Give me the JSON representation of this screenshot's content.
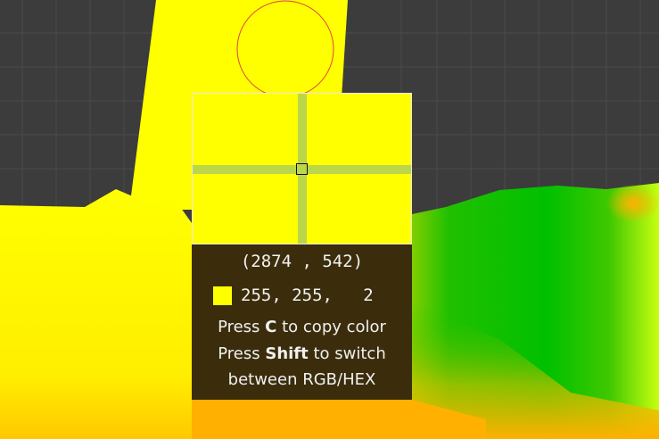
{
  "colors": {
    "background": "#3c3c3c",
    "grid": "#4a4a4a",
    "yellow": "#ffff00",
    "green": "#00c000",
    "orange": "#ffb000",
    "lime": "#c0ff00",
    "crosshair": "#bcd64a",
    "panel": "#3b2d0c",
    "ring": "#e04040"
  },
  "picker": {
    "coordinates": "(2874 , 542)",
    "rgb_value": "255, 255,   2",
    "swatch_color": "#ffff02",
    "hint_copy_prefix": "Press ",
    "hint_copy_key": "C",
    "hint_copy_suffix": " to copy color",
    "hint_switch_prefix": "Press ",
    "hint_switch_key": "Shift",
    "hint_switch_suffix": " to switch",
    "hint_switch_line2": "between RGB/HEX"
  },
  "icons": {
    "cursor_ring": "circle-cursor-icon",
    "crosshair": "crosshair-icon"
  }
}
